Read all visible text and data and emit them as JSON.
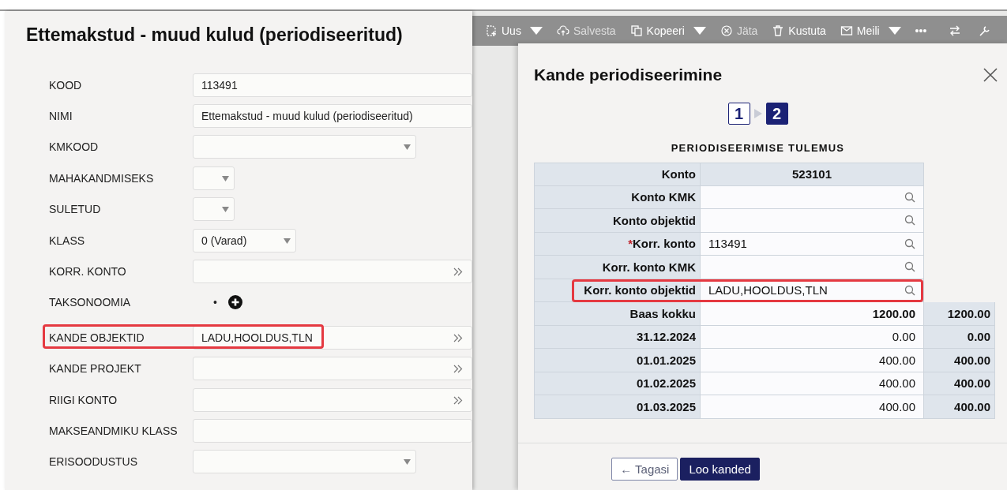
{
  "form": {
    "title": "Ettemakstud - muud kulud (periodiseeritud)",
    "rows": [
      {
        "label": "KOOD",
        "kind": "input",
        "value": "113491",
        "highlighted": false
      },
      {
        "label": "NIMI",
        "kind": "input",
        "value": "Ettemakstud - muud kulud (periodiseeritud)",
        "highlighted": false
      },
      {
        "label": "KMKOOD",
        "kind": "select-wide",
        "highlighted": false
      },
      {
        "label": "MAHAKANDMISEKS",
        "kind": "select-small",
        "highlighted": false
      },
      {
        "label": "SULETUD",
        "kind": "select-small",
        "highlighted": false
      },
      {
        "label": "KLASS",
        "kind": "select-medium",
        "value": "0 (Varad)",
        "highlighted": false
      },
      {
        "label": "KORR. KONTO",
        "kind": "picker",
        "highlighted": false
      },
      {
        "label": "TAKSONOOMIA",
        "kind": "taxonomy",
        "bullet": "•",
        "highlighted": false
      },
      {
        "label": "KANDE OBJEKTID",
        "kind": "picker",
        "value": "LADU,HOOLDUS,TLN",
        "highlighted": true
      },
      {
        "label": "KANDE PROJEKT",
        "kind": "picker",
        "highlighted": false
      },
      {
        "label": "RIIGI KONTO",
        "kind": "picker",
        "highlighted": false
      },
      {
        "label": "MAKSEANDMIKU KLASS",
        "kind": "input",
        "highlighted": false
      },
      {
        "label": "ERISOODUSTUS",
        "kind": "select-wide",
        "highlighted": false
      }
    ]
  },
  "background_app": {
    "toolbar": [
      {
        "label": "Uus",
        "caret": true,
        "disabled": false
      },
      {
        "label": "Salvesta",
        "caret": false,
        "disabled": true
      },
      {
        "label": "Kopeeri",
        "caret": true,
        "disabled": false
      },
      {
        "label": "Jäta",
        "caret": false,
        "disabled": true
      },
      {
        "label": "Kustuta",
        "caret": false,
        "disabled": false
      },
      {
        "label": "Meili",
        "caret": true,
        "disabled": false
      },
      {
        "label": "•••",
        "caret": false,
        "disabled": false
      }
    ]
  },
  "modal": {
    "title": "Kande periodiseerimine",
    "steps": [
      {
        "label": "1",
        "selected": false
      },
      {
        "label": "2",
        "selected": true
      }
    ],
    "heading": "PERIODISEERIMISE TULEMUS",
    "rows": [
      {
        "kind": "header",
        "label": "Konto",
        "value": "523101"
      },
      {
        "kind": "lookup",
        "label": "Konto KMK",
        "highlighted": false
      },
      {
        "kind": "lookup",
        "label": "Konto objektid",
        "highlighted": false
      },
      {
        "kind": "lookup",
        "label": "Korr. konto",
        "value": "113491",
        "required_mark": "*",
        "highlighted": false
      },
      {
        "kind": "lookup",
        "label": "Korr. konto KMK",
        "highlighted": false
      },
      {
        "kind": "lookup",
        "label": "Korr. konto objektid",
        "value": "LADU,HOOLDUS,TLN",
        "highlighted": true
      },
      {
        "kind": "total",
        "label": "Baas kokku",
        "value": "1200.00",
        "total": "1200.00"
      },
      {
        "kind": "period",
        "label": "31.12.2024",
        "value": "0.00",
        "total": "0.00"
      },
      {
        "kind": "period",
        "label": "01.01.2025",
        "value": "400.00",
        "total": "400.00"
      },
      {
        "kind": "period",
        "label": "01.02.2025",
        "value": "400.00",
        "total": "400.00"
      },
      {
        "kind": "period",
        "label": "01.03.2025",
        "value": "400.00",
        "total": "400.00"
      }
    ],
    "buttons": [
      {
        "label": "← Tagasi",
        "kind": "secondary"
      },
      {
        "label": "Loo kanded",
        "kind": "primary"
      }
    ]
  }
}
